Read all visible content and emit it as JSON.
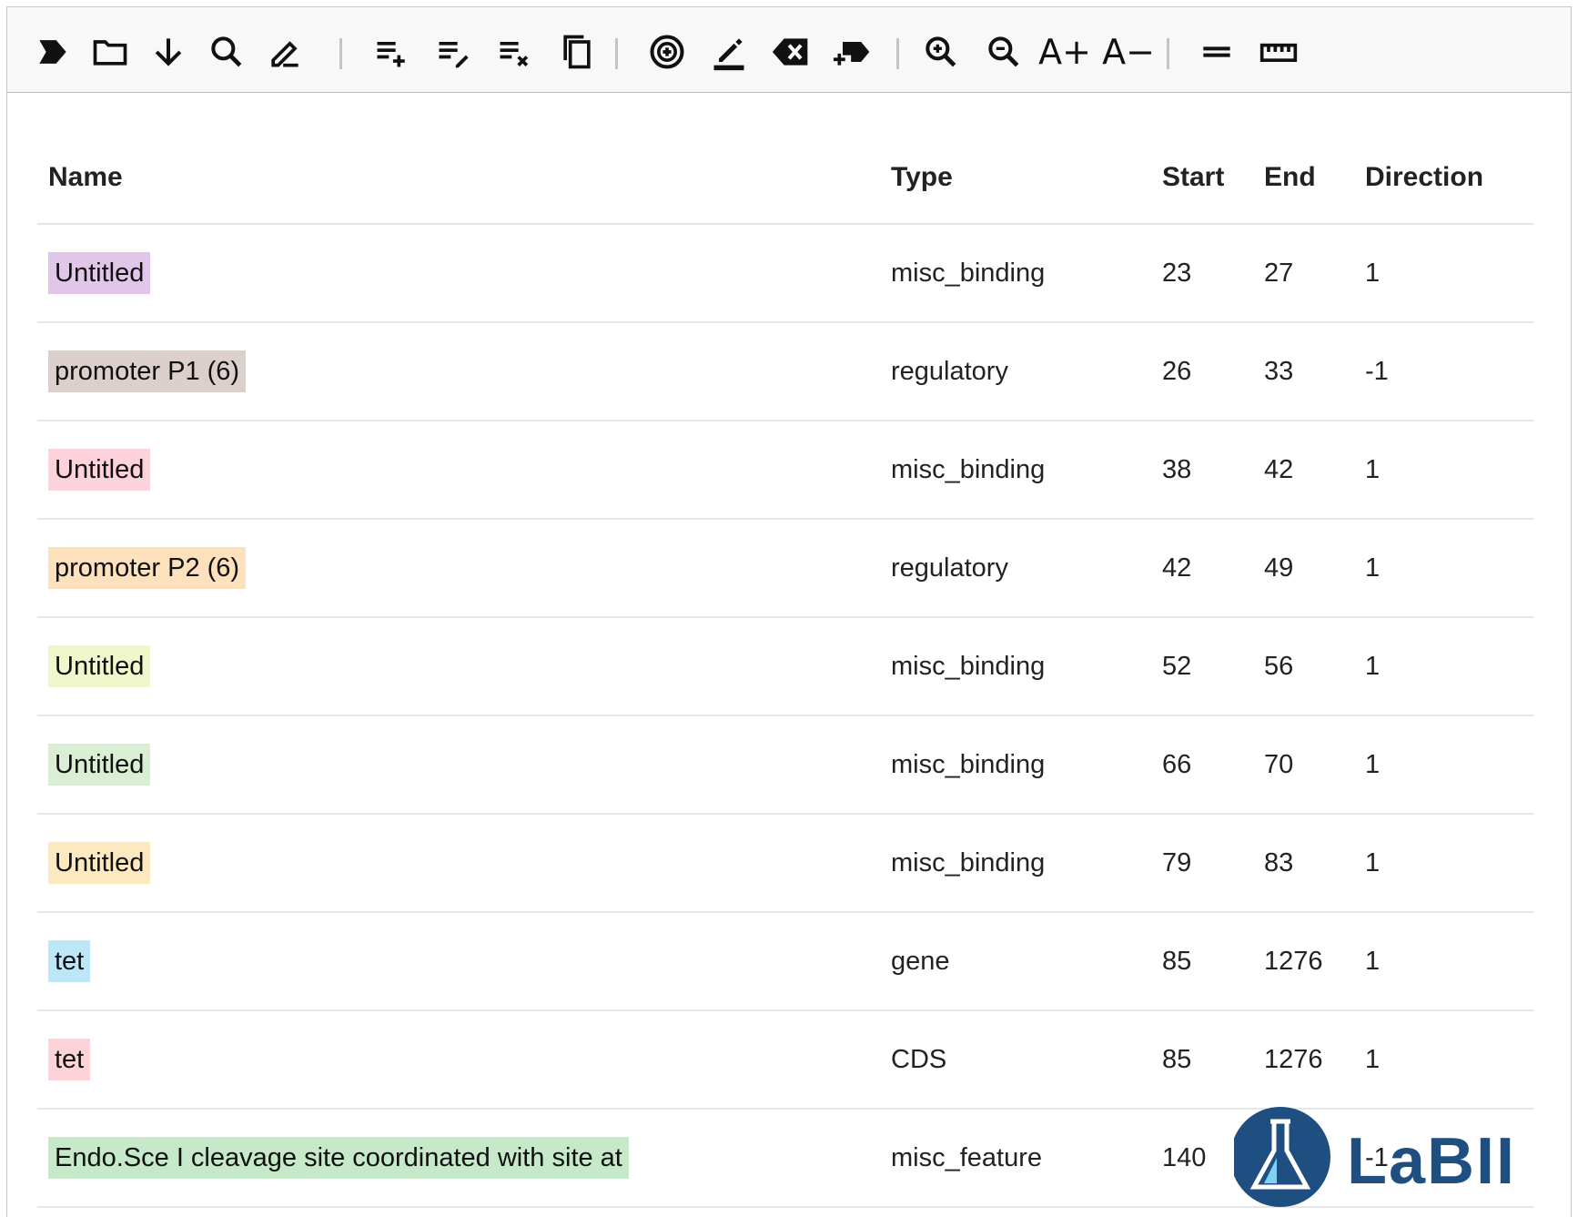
{
  "toolbar": {
    "icons": [
      "expand-icon",
      "folder-icon",
      "download-icon",
      "search-icon",
      "edit-icon",
      "add-list-icon",
      "edit-list-icon",
      "clear-list-icon",
      "copy-icon",
      "add-circle-icon",
      "highlight-icon",
      "delete-icon",
      "insert-icon",
      "zoom-in-icon",
      "zoom-out-icon"
    ],
    "font_increase_label": "A+",
    "font_decrease_label": "A−",
    "icons2": [
      "line-spacing-icon",
      "ruler-icon"
    ]
  },
  "table": {
    "headers": {
      "name": "Name",
      "type": "Type",
      "start": "Start",
      "end": "End",
      "direction": "Direction"
    },
    "rows": [
      {
        "name": "Untitled",
        "type": "misc_binding",
        "start": "23",
        "end": "27",
        "direction": "1",
        "color": "#e2c6ea"
      },
      {
        "name": "promoter P1 (6)",
        "type": "regulatory",
        "start": "26",
        "end": "33",
        "direction": "-1",
        "color": "#dcd0cd"
      },
      {
        "name": "Untitled",
        "type": "misc_binding",
        "start": "38",
        "end": "42",
        "direction": "1",
        "color": "#fdd2da"
      },
      {
        "name": "promoter P2 (6)",
        "type": "regulatory",
        "start": "42",
        "end": "49",
        "direction": "1",
        "color": "#fde0bc"
      },
      {
        "name": "Untitled",
        "type": "misc_binding",
        "start": "52",
        "end": "56",
        "direction": "1",
        "color": "#f1f7cb"
      },
      {
        "name": "Untitled",
        "type": "misc_binding",
        "start": "66",
        "end": "70",
        "direction": "1",
        "color": "#d9eed3"
      },
      {
        "name": "Untitled",
        "type": "misc_binding",
        "start": "79",
        "end": "83",
        "direction": "1",
        "color": "#fde9bf"
      },
      {
        "name": "tet",
        "type": "gene",
        "start": "85",
        "end": "1276",
        "direction": "1",
        "color": "#bde6f8"
      },
      {
        "name": "tet",
        "type": "CDS",
        "start": "85",
        "end": "1276",
        "direction": "1",
        "color": "#fdd2d8"
      },
      {
        "name": "Endo.Sce I cleavage site coordinated with site at",
        "type": "misc_feature",
        "start": "140",
        "end": "",
        "direction": "-1",
        "color": "#c6e9c9"
      }
    ]
  },
  "logo": {
    "text": "LaBII",
    "color": "#1f4f80"
  }
}
